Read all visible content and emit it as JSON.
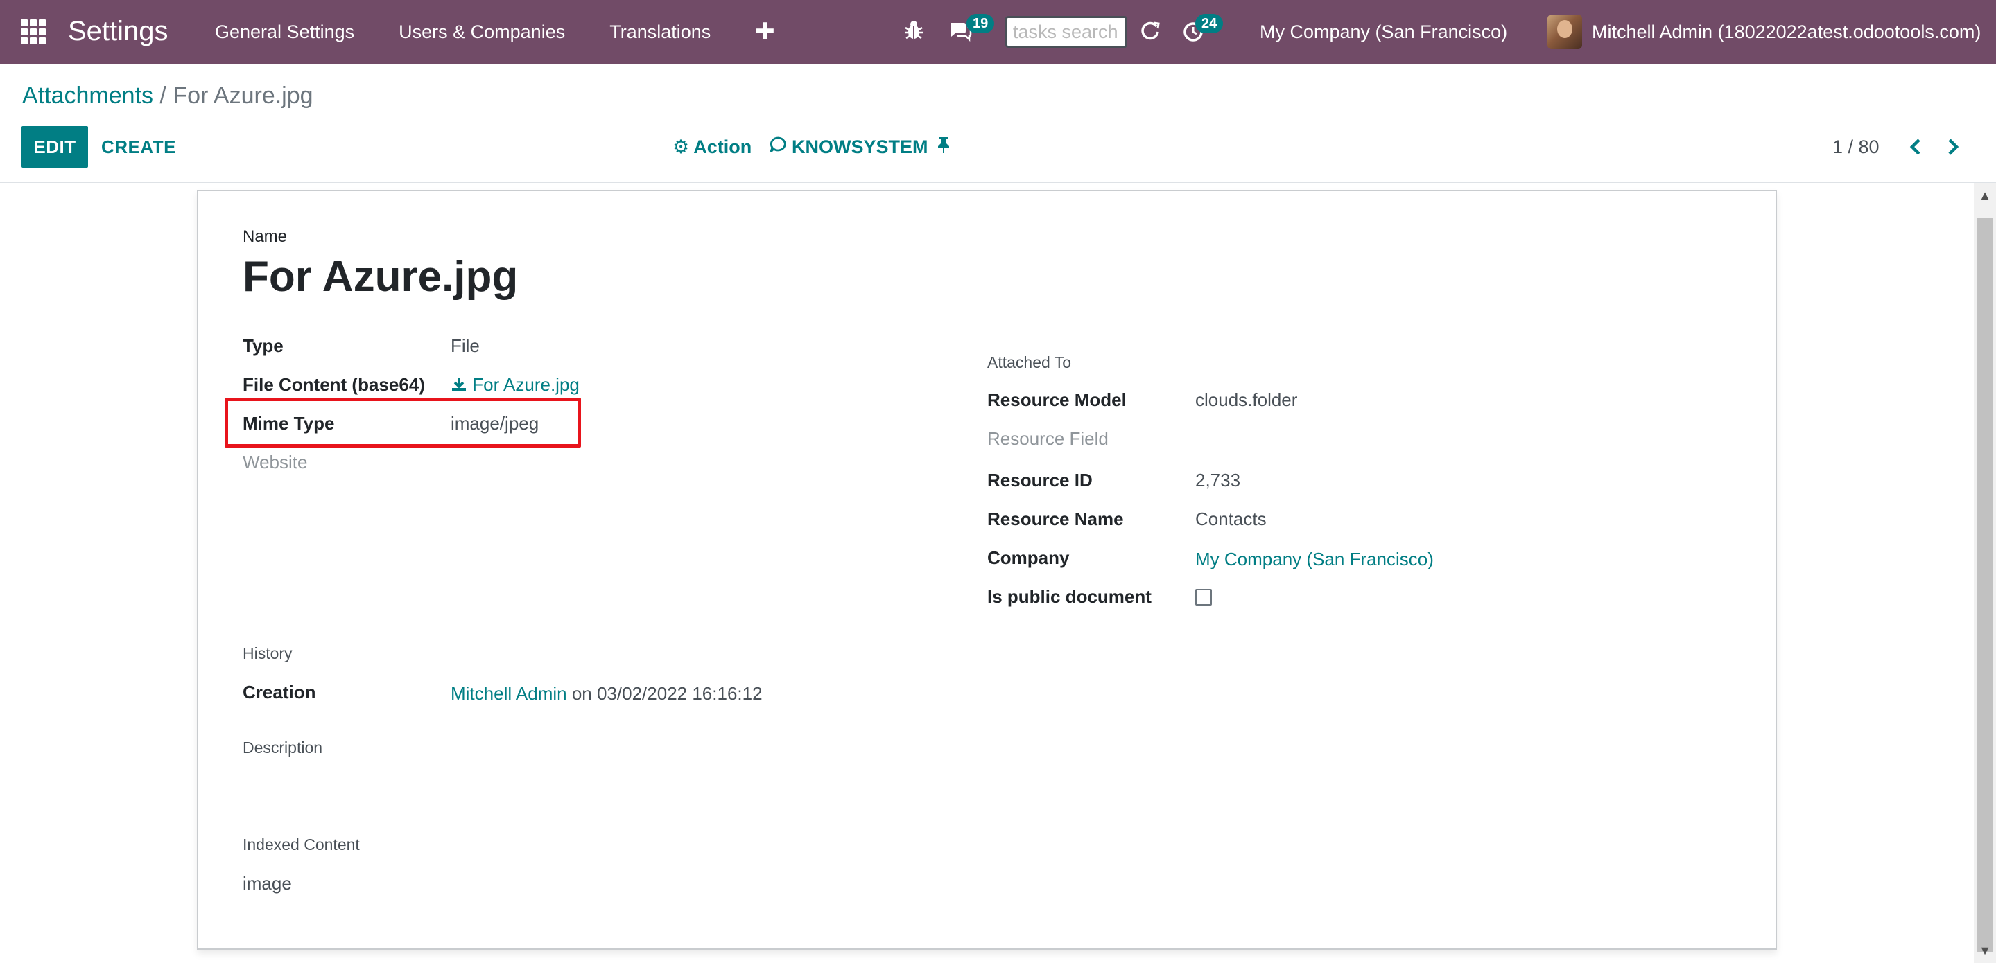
{
  "navbar": {
    "app_title": "Settings",
    "menu": [
      "General Settings",
      "Users & Companies",
      "Translations"
    ],
    "messages_badge": "19",
    "activities_badge": "24",
    "tasks_search_placeholder": "tasks search",
    "company": "My Company (San Francisco)",
    "user": "Mitchell Admin (18022022atest.odootools.com)"
  },
  "control": {
    "breadcrumb_parent": "Attachments",
    "breadcrumb_sep": " / ",
    "breadcrumb_current": "For Azure.jpg",
    "edit_label": "EDIT",
    "create_label": "CREATE",
    "action_label": "Action",
    "knowsystem_label": "KNOWSYSTEM",
    "pager": "1 / 80"
  },
  "form": {
    "name_label": "Name",
    "name_value": "For Azure.jpg",
    "type_label": "Type",
    "type_value": "File",
    "file_content_label": "File Content (base64)",
    "file_content_value": "For Azure.jpg",
    "mime_type_label": "Mime Type",
    "mime_type_value": "image/jpeg",
    "website_label": "Website",
    "attached_to_title": "Attached To",
    "resource_model_label": "Resource Model",
    "resource_model_value": "clouds.folder",
    "resource_field_label": "Resource Field",
    "resource_id_label": "Resource ID",
    "resource_id_value": "2,733",
    "resource_name_label": "Resource Name",
    "resource_name_value": "Contacts",
    "company_label": "Company",
    "company_value": "My Company (San Francisco)",
    "public_label": "Is public document",
    "history_title": "History",
    "creation_label": "Creation",
    "creation_user": "Mitchell Admin",
    "creation_date": " on 03/02/2022 16:16:12",
    "description_title": "Description",
    "indexed_title": "Indexed Content",
    "indexed_value": "image"
  },
  "colors": {
    "navbar": "#714b67",
    "accent": "#017e84",
    "highlight": "#e8141c"
  }
}
